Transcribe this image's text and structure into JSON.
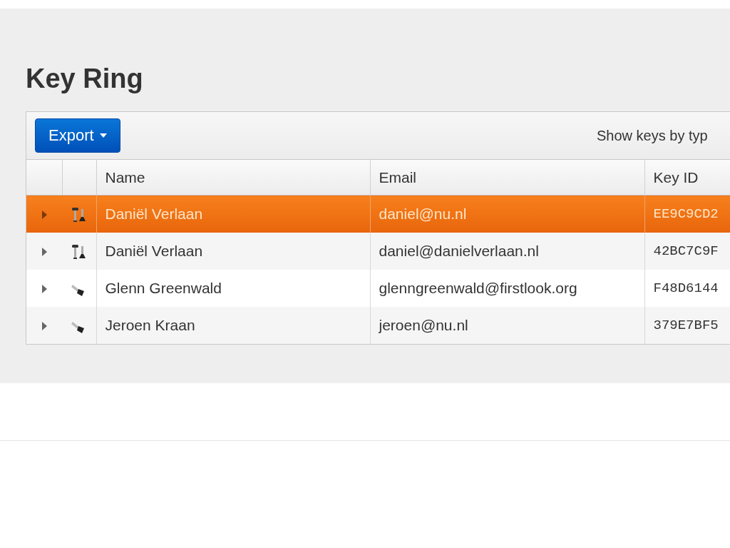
{
  "page": {
    "title": "Key Ring"
  },
  "toolbar": {
    "export_button": "Export",
    "filter_label": "Show keys by typ"
  },
  "table": {
    "columns": [
      "Name",
      "Email",
      "Key ID"
    ],
    "rows": [
      {
        "kind": "pair",
        "selected": true,
        "name": "Daniël Verlaan",
        "email": "daniel@nu.nl",
        "key_id": "EE9C9CD2"
      },
      {
        "kind": "pair",
        "selected": false,
        "name": "Daniël Verlaan",
        "email": "daniel@danielverlaan.nl",
        "key_id": "42BC7C9F"
      },
      {
        "kind": "public",
        "selected": false,
        "name": "Glenn Greenwald",
        "email": "glenngreenwald@firstlook.org",
        "key_id": "F48D6144"
      },
      {
        "kind": "public",
        "selected": false,
        "name": "Jeroen Kraan",
        "email": "jeroen@nu.nl",
        "key_id": "379E7BF5"
      }
    ]
  }
}
